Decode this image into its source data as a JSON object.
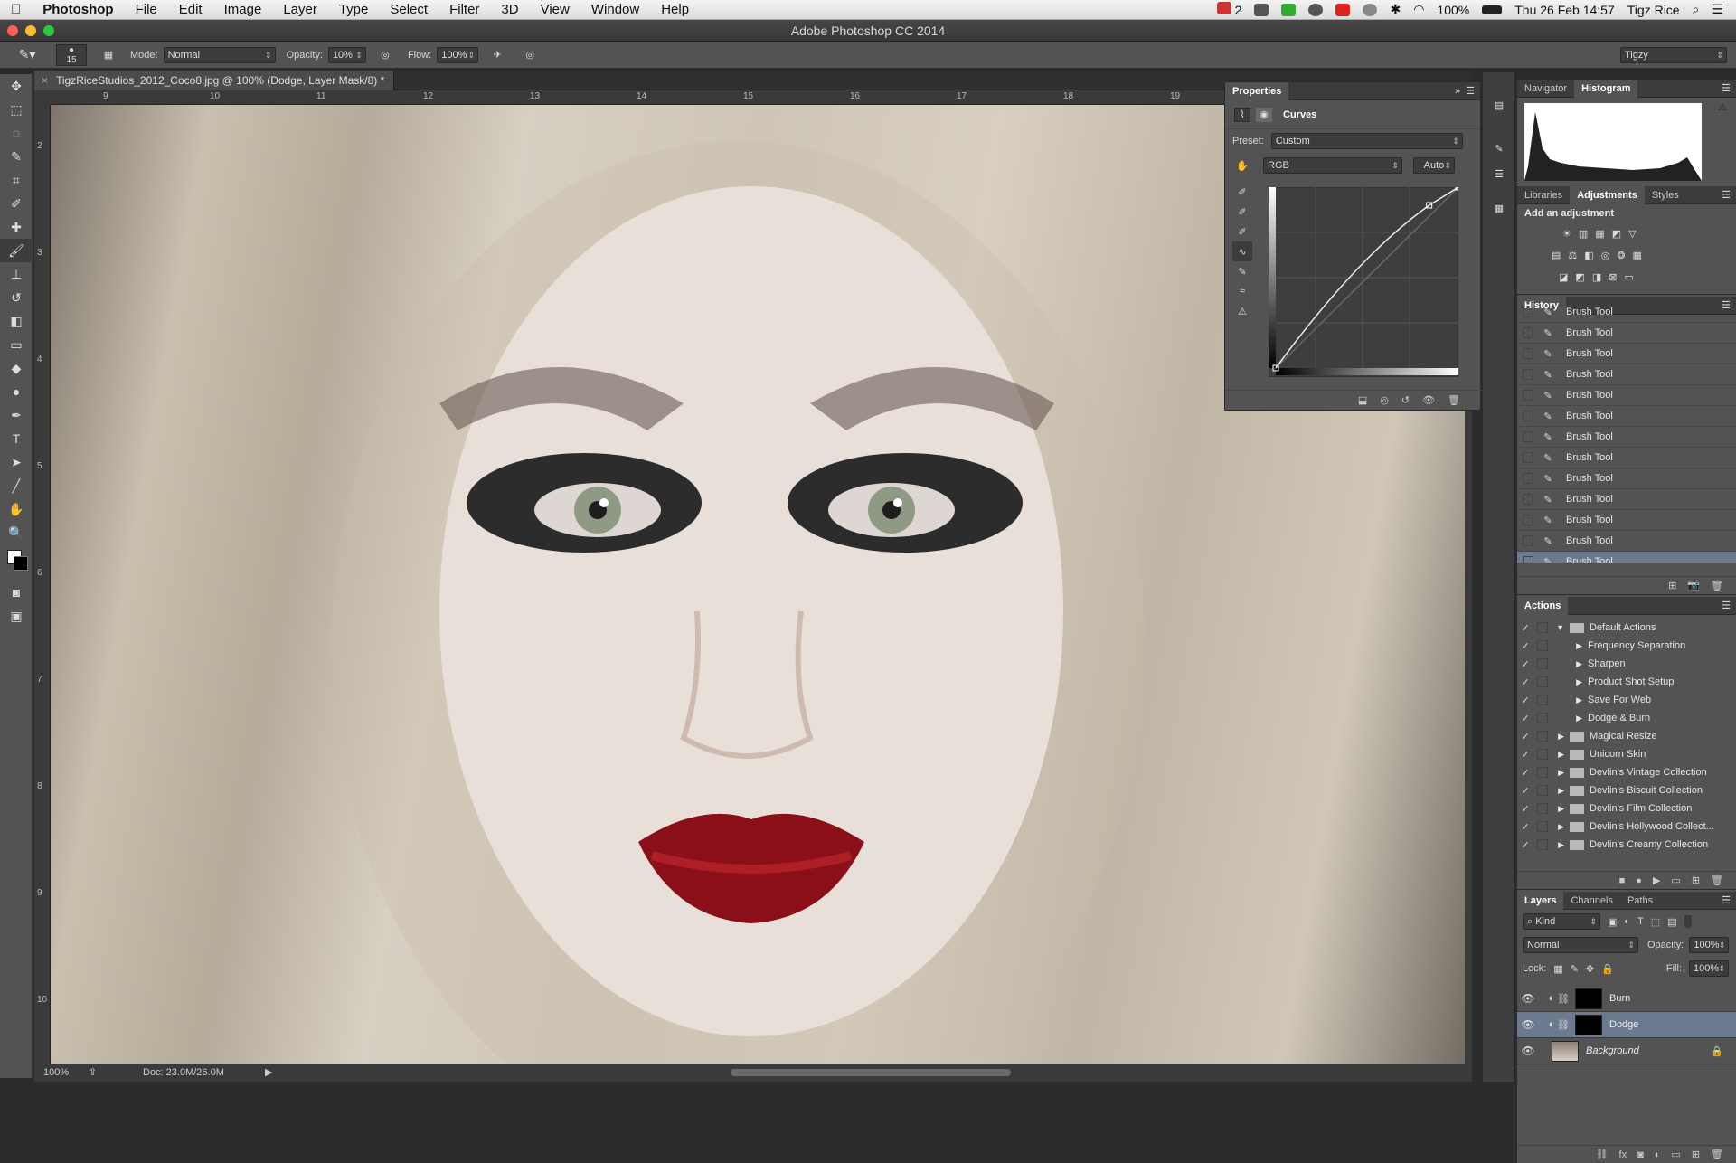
{
  "menubar": {
    "apple_icon": "apple-icon",
    "app_name": "Photoshop",
    "menus": [
      "File",
      "Edit",
      "Image",
      "Layer",
      "Type",
      "Select",
      "Filter",
      "3D",
      "View",
      "Window",
      "Help"
    ],
    "status": {
      "notify_count": "2",
      "battery": "100%",
      "datetime": "Thu 26 Feb  14:57",
      "user": "Tigz Rice"
    }
  },
  "window": {
    "title": "Adobe Photoshop CC 2014"
  },
  "options": {
    "brush_size": "15",
    "mode_label": "Mode:",
    "mode_value": "Normal",
    "opacity_label": "Opacity:",
    "opacity_value": "10%",
    "flow_label": "Flow:",
    "flow_value": "100%",
    "workspace": "Tigzy"
  },
  "document": {
    "tab_title": "TigzRiceStudios_2012_Coco8.jpg @ 100% (Dodge, Layer Mask/8) *",
    "hruler_ticks": [
      "9",
      "10",
      "11",
      "12",
      "13",
      "14",
      "15",
      "16",
      "17",
      "18",
      "19"
    ],
    "vruler_ticks": [
      "2",
      "3",
      "4",
      "5",
      "6",
      "7",
      "8",
      "9",
      "10"
    ],
    "zoom": "100%",
    "doc_size": "Doc: 23.0M/26.0M"
  },
  "properties": {
    "title": "Properties",
    "adjustment": "Curves",
    "preset_label": "Preset:",
    "preset_value": "Custom",
    "channel": "RGB",
    "auto_button": "Auto",
    "curve_points": [
      [
        0,
        0
      ],
      [
        0.84,
        0.9
      ],
      [
        1,
        1
      ]
    ]
  },
  "navigator": {
    "tabs": [
      "Navigator",
      "Histogram"
    ],
    "active": "Histogram"
  },
  "adjustments": {
    "tabs": [
      "Libraries",
      "Adjustments",
      "Styles"
    ],
    "heading": "Add an adjustment"
  },
  "history": {
    "title": "History",
    "items": [
      "Brush Tool",
      "Brush Tool",
      "Brush Tool",
      "Brush Tool",
      "Brush Tool",
      "Brush Tool",
      "Brush Tool",
      "Brush Tool",
      "Brush Tool",
      "Brush Tool",
      "Brush Tool",
      "Brush Tool",
      "Brush Tool"
    ]
  },
  "actions": {
    "title": "Actions",
    "items": [
      {
        "label": "Default Actions",
        "level": 0,
        "open": true
      },
      {
        "label": "Frequency Separation",
        "level": 1
      },
      {
        "label": "Sharpen",
        "level": 1
      },
      {
        "label": "Product Shot Setup",
        "level": 1
      },
      {
        "label": "Save For Web",
        "level": 1
      },
      {
        "label": "Dodge & Burn",
        "level": 1
      },
      {
        "label": "Magical Resize",
        "level": 0
      },
      {
        "label": "Unicorn Skin",
        "level": 0
      },
      {
        "label": "Devlin's Vintage Collection",
        "level": 0
      },
      {
        "label": "Devlin's Biscuit Collection",
        "level": 0
      },
      {
        "label": "Devlin's Film Collection",
        "level": 0
      },
      {
        "label": "Devlin's Hollywood Collect...",
        "level": 0
      },
      {
        "label": "Devlin's Creamy Collection",
        "level": 0
      }
    ]
  },
  "layers": {
    "tabs": [
      "Layers",
      "Channels",
      "Paths"
    ],
    "filter": "Kind",
    "blend_mode": "Normal",
    "opacity_label": "Opacity:",
    "opacity_value": "100%",
    "lock_label": "Lock:",
    "fill_label": "Fill:",
    "fill_value": "100%",
    "items": [
      {
        "name": "Burn",
        "selected": false
      },
      {
        "name": "Dodge",
        "selected": true
      },
      {
        "name": "Background",
        "selected": false
      }
    ]
  }
}
